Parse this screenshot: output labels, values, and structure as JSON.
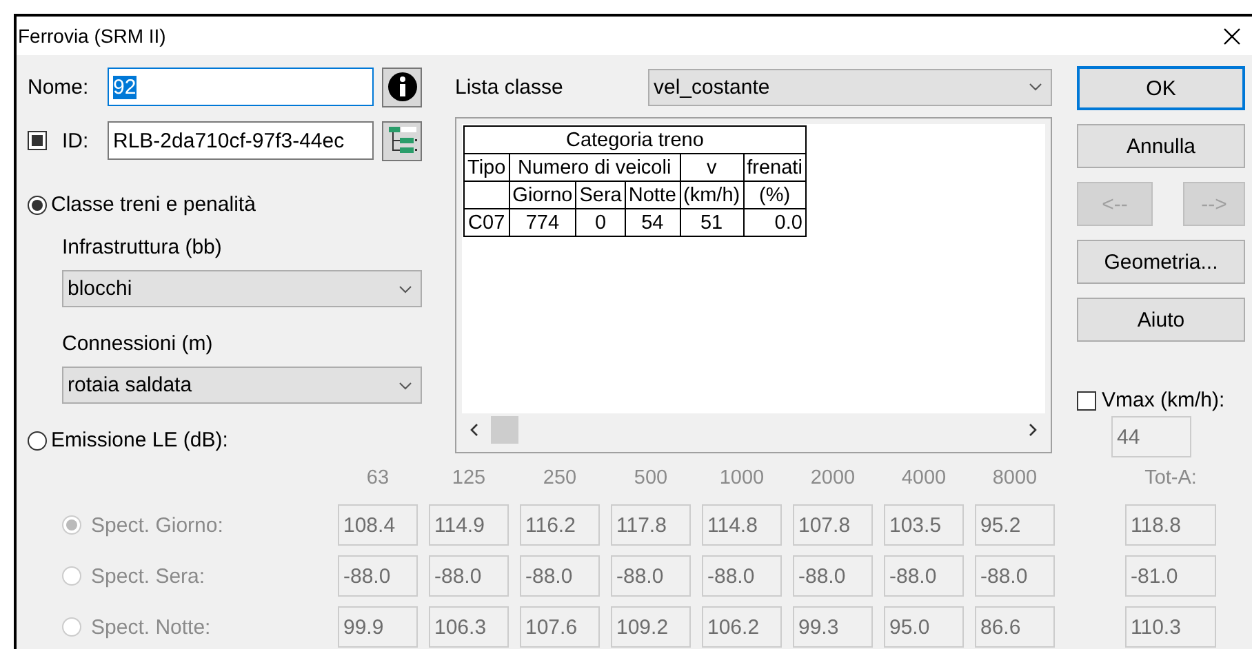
{
  "window": {
    "title": "Ferrovia (SRM II)"
  },
  "name_field": {
    "label": "Nome:",
    "value": "92",
    "highlighted": true
  },
  "id_field": {
    "label": "ID:",
    "value": "RLB-2da710cf-97f3-44ec",
    "checked": true
  },
  "modes": [
    {
      "label": "Classe treni e penalità",
      "selected": true
    },
    {
      "label": "Emissione LE (dB):",
      "selected": false
    }
  ],
  "infrastructure": {
    "label": "Infrastruttura (bb)",
    "value": "blocchi"
  },
  "connections": {
    "label": "Connessioni (m)",
    "value": "rotaia saldata"
  },
  "class_list": {
    "label": "Lista classe",
    "value": "vel_costante"
  },
  "table": {
    "header_rows": [
      [
        {
          "text": "Categoria treno",
          "colspan": 6
        }
      ],
      [
        {
          "text": "Tipo"
        },
        {
          "text": "Numero di veicoli",
          "colspan": 3
        },
        {
          "text": "v"
        },
        {
          "text": "frenati"
        }
      ],
      [
        {},
        {
          "text": "Giorno"
        },
        {
          "text": "Sera"
        },
        {
          "text": "Notte"
        },
        {
          "text": "(km/h)"
        },
        {
          "text": "(%)"
        }
      ]
    ],
    "rows": [
      [
        "C07",
        "774",
        "0",
        "54",
        "51",
        "0.0"
      ]
    ]
  },
  "buttons": [
    {
      "label": "OK",
      "default": true,
      "disabled": false
    },
    {
      "label": "Annulla",
      "default": false,
      "disabled": false
    },
    {
      "label": "<--",
      "default": false,
      "disabled": true
    },
    {
      "label": "-->",
      "default": false,
      "disabled": true
    },
    {
      "label": "Geometria...",
      "default": false,
      "disabled": false
    },
    {
      "label": "Aiuto",
      "default": false,
      "disabled": false
    }
  ],
  "vmax": {
    "label": "Vmax (km/h):",
    "checked": false,
    "value": "44",
    "disabled": true
  },
  "spectrum": {
    "disabled": true,
    "bands": [
      "63",
      "125",
      "250",
      "500",
      "1000",
      "2000",
      "4000",
      "8000"
    ],
    "total_label": "Tot-A:",
    "rows": [
      {
        "label": "Spect. Giorno:",
        "selected": true,
        "values": [
          "108.4",
          "114.9",
          "116.2",
          "117.8",
          "114.8",
          "107.8",
          "103.5",
          "95.2"
        ],
        "total": "118.8"
      },
      {
        "label": "Spect. Sera:",
        "selected": false,
        "values": [
          "-88.0",
          "-88.0",
          "-88.0",
          "-88.0",
          "-88.0",
          "-88.0",
          "-88.0",
          "-88.0"
        ],
        "total": "-81.0"
      },
      {
        "label": "Spect. Notte:",
        "selected": false,
        "values": [
          "99.9",
          "106.3",
          "107.6",
          "109.2",
          "106.2",
          "99.3",
          "95.0",
          "86.6"
        ],
        "total": "110.3"
      }
    ]
  }
}
